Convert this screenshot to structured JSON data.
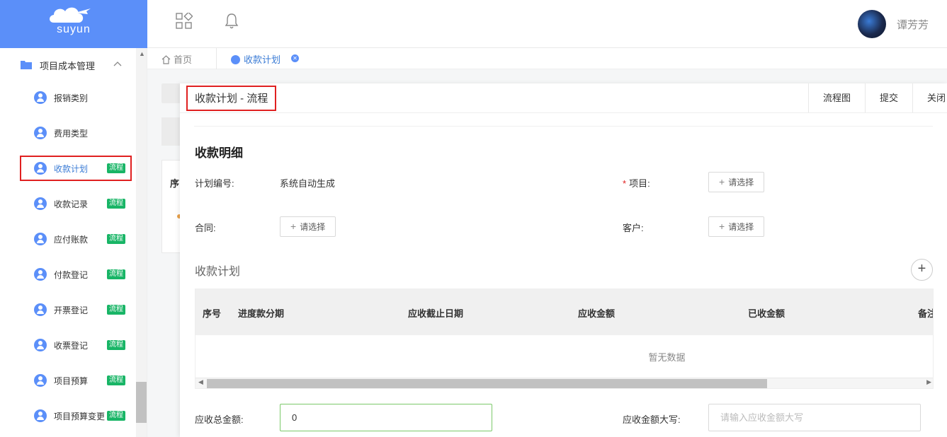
{
  "brand": {
    "name": "suyun"
  },
  "header": {
    "user_name": "谭芳芳"
  },
  "sidebar": {
    "group": {
      "label": "项目成本管理"
    },
    "items": [
      {
        "label": "报销类别",
        "badge": ""
      },
      {
        "label": "费用类型",
        "badge": ""
      },
      {
        "label": "收款计划",
        "badge": "流程",
        "active": true
      },
      {
        "label": "收款记录",
        "badge": "流程"
      },
      {
        "label": "应付账款",
        "badge": "流程"
      },
      {
        "label": "付款登记",
        "badge": "流程"
      },
      {
        "label": "开票登记",
        "badge": "流程"
      },
      {
        "label": "收票登记",
        "badge": "流程"
      },
      {
        "label": "项目预算",
        "badge": "流程"
      },
      {
        "label": "项目预算变更",
        "badge": "流程"
      }
    ]
  },
  "tabs": {
    "home": "首页",
    "current": "收款计划"
  },
  "background": {
    "col_fragment": "序"
  },
  "dialog": {
    "title": "收款计划 - 流程",
    "actions": {
      "flowchart": "流程图",
      "submit": "提交",
      "close": "关闭"
    },
    "section_title": "收款明细",
    "fields": {
      "plan_no_label": "计划编号:",
      "plan_no_value": "系统自动生成",
      "project_label": "项目:",
      "contract_label": "合同:",
      "customer_label": "客户:",
      "pick_label": "请选择",
      "total_label": "应收总金额:",
      "total_value": "0",
      "amount_upper_label": "应收金额大写:",
      "amount_upper_placeholder": "请输入应收金额大写"
    },
    "plan_section": "收款计划",
    "table": {
      "columns": [
        "序号",
        "进度款分期",
        "应收截止日期",
        "应收金额",
        "已收金额",
        "备注"
      ],
      "empty_text": "暂无数据"
    }
  },
  "colors": {
    "brand": "#5b8ff9",
    "badge": "#18b566",
    "highlight": "#e02020"
  }
}
